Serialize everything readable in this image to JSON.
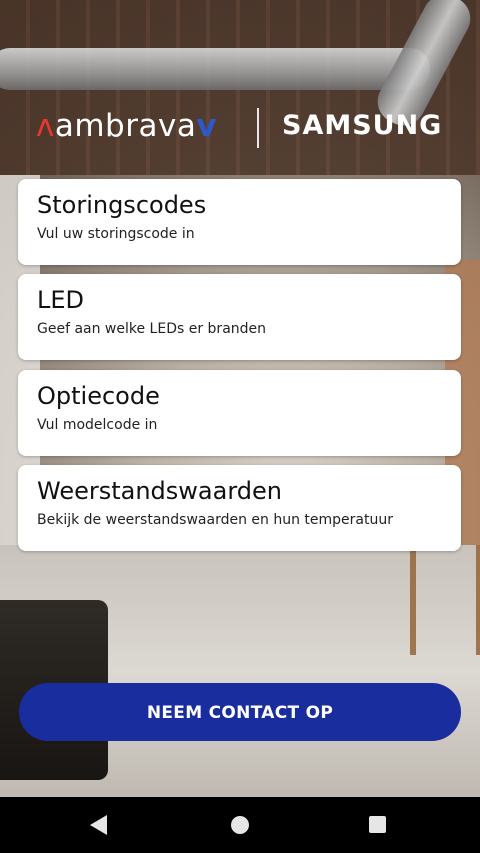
{
  "header": {
    "brand_left_mark": "ʌ",
    "brand_left_text": "ambrava",
    "brand_left_v": "v",
    "brand_right": "SAMSUNG"
  },
  "menu": {
    "items": [
      {
        "title": "Storingscodes",
        "subtitle": "Vul uw storingscode in"
      },
      {
        "title": "LED",
        "subtitle": "Geef aan welke LEDs er branden"
      },
      {
        "title": "Optiecode",
        "subtitle": "Vul modelcode in"
      },
      {
        "title": "Weerstandswaarden",
        "subtitle": "Bekijk de weerstandswaarden en hun temperatuur"
      }
    ]
  },
  "contact": {
    "label": "NEEM CONTACT OP"
  },
  "navbar": {
    "back_icon": "back-triangle",
    "home_icon": "home-circle",
    "recent_icon": "recent-square"
  },
  "colors": {
    "primary_button": "#1a2d9e",
    "ambrava_red": "#e8372f",
    "ambrava_blue": "#2e57c8",
    "card_bg": "#ffffff"
  }
}
